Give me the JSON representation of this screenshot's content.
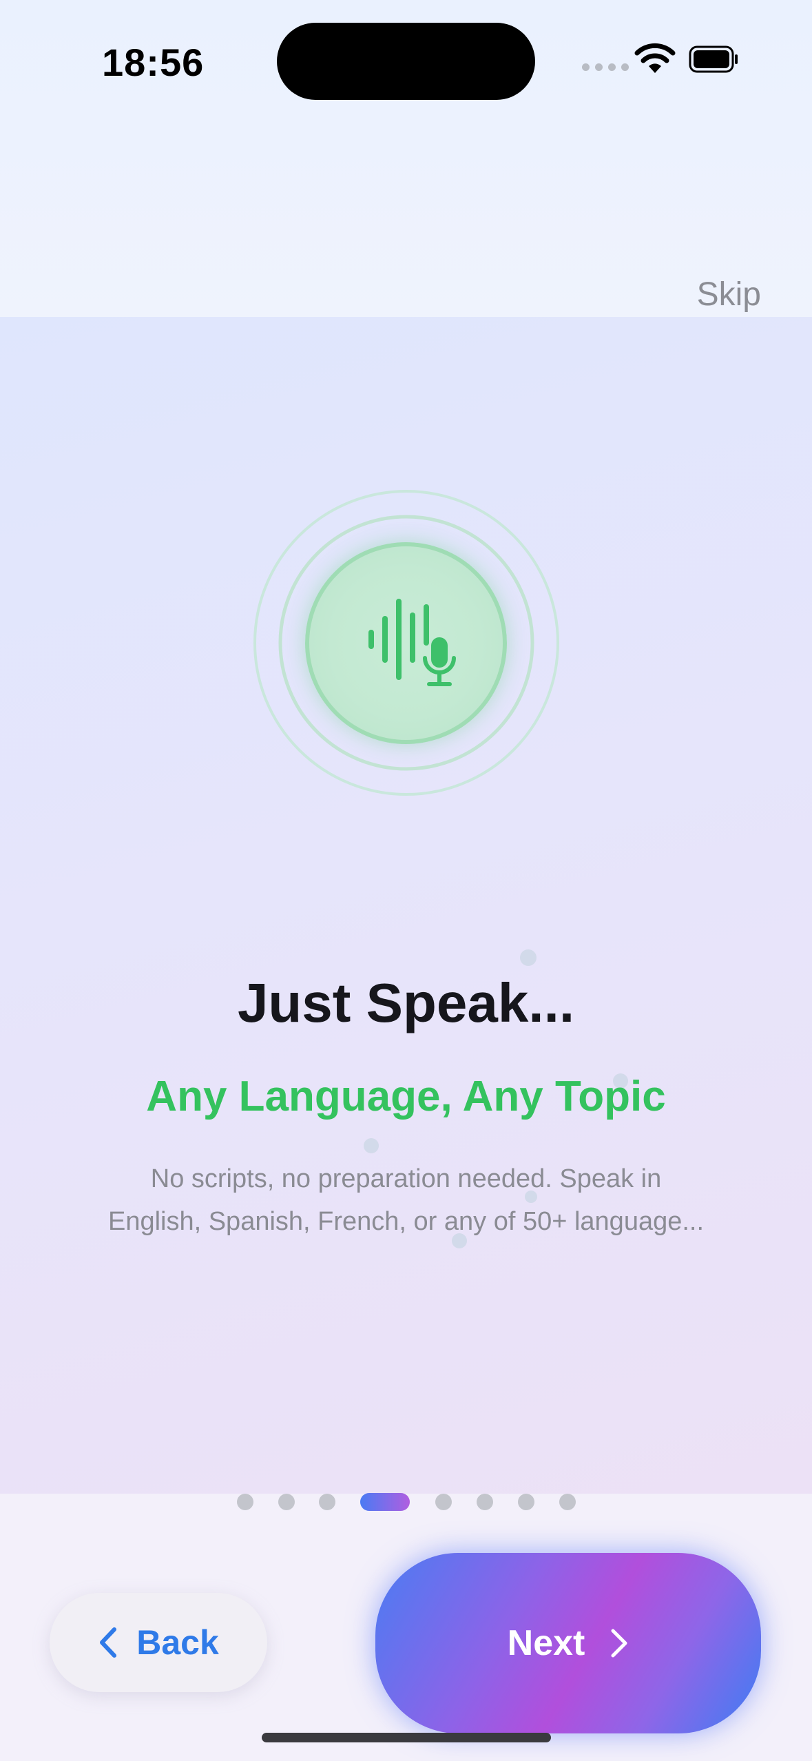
{
  "status_bar": {
    "time": "18:56"
  },
  "header": {
    "skip_label": "Skip"
  },
  "onboarding": {
    "title": "Just Speak...",
    "subtitle": "Any Language, Any Topic",
    "description": "No scripts, no preparation needed. Speak in English, Spanish, French, or any of 50+ language...",
    "description_line1": "No scripts, no preparation needed. Speak in",
    "description_line2": "English, Spanish, French, or any of 50+ language...",
    "hero_icon": "waveform-mic-icon"
  },
  "pagination": {
    "total": 8,
    "current": 4
  },
  "footer": {
    "back_label": "Back",
    "next_label": "Next"
  },
  "colors": {
    "accent_green": "#34c25e",
    "accent_blue": "#2f7ae8",
    "gradient_start": "#4b7cf2",
    "gradient_mid": "#b14fdc"
  }
}
